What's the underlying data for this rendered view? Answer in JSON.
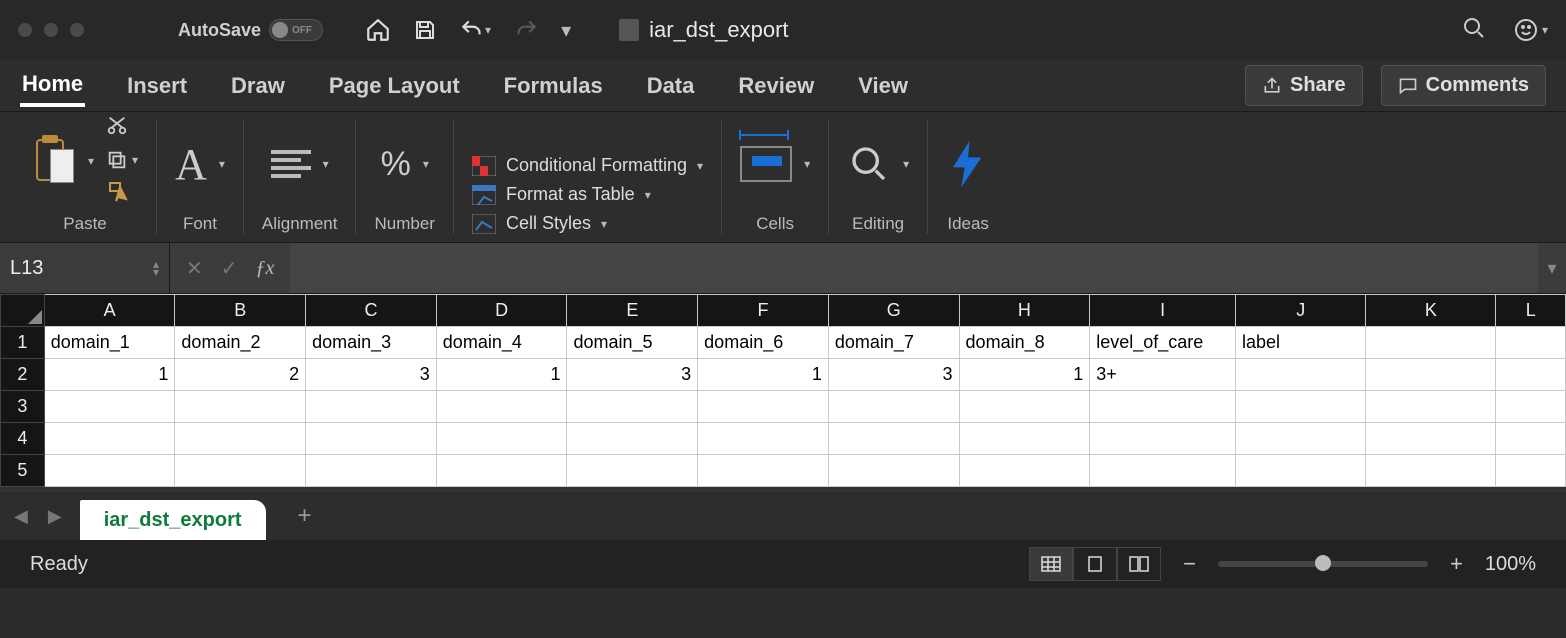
{
  "titlebar": {
    "autosave_label": "AutoSave",
    "autosave_state": "OFF",
    "doc_title": "iar_dst_export"
  },
  "ribbon": {
    "tabs": [
      "Home",
      "Insert",
      "Draw",
      "Page Layout",
      "Formulas",
      "Data",
      "Review",
      "View"
    ],
    "active_tab": "Home",
    "share_label": "Share",
    "comments_label": "Comments",
    "groups": {
      "paste": "Paste",
      "font": "Font",
      "alignment": "Alignment",
      "number": "Number",
      "cond_fmt": "Conditional Formatting",
      "fmt_table": "Format as Table",
      "cell_styles": "Cell Styles",
      "cells": "Cells",
      "editing": "Editing",
      "ideas": "Ideas"
    }
  },
  "formula_bar": {
    "namebox": "L13",
    "formula": ""
  },
  "grid": {
    "columns": [
      "A",
      "B",
      "C",
      "D",
      "E",
      "F",
      "G",
      "H",
      "I",
      "J",
      "K",
      "L"
    ],
    "row_numbers": [
      "1",
      "2",
      "3",
      "4",
      "5"
    ],
    "headers": [
      "domain_1",
      "domain_2",
      "domain_3",
      "domain_4",
      "domain_5",
      "domain_6",
      "domain_7",
      "domain_8",
      "level_of_care",
      "label"
    ],
    "data_row": [
      "1",
      "2",
      "3",
      "1",
      "3",
      "1",
      "3",
      "1",
      "3+",
      ""
    ]
  },
  "sheets": {
    "active": "iar_dst_export"
  },
  "status": {
    "ready": "Ready",
    "zoom": "100%"
  }
}
